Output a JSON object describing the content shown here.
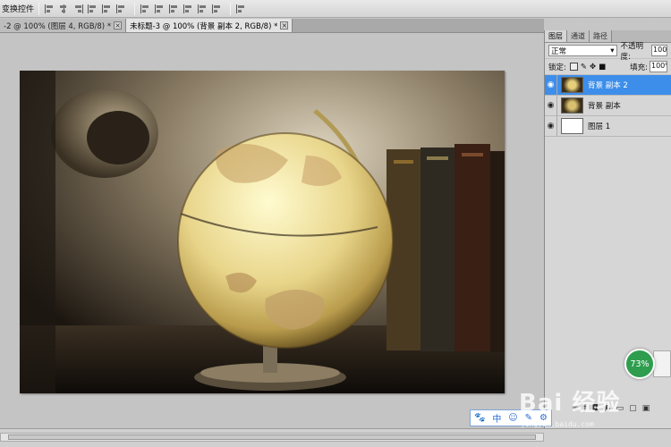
{
  "options_bar": {
    "label": "变换控件"
  },
  "tabs": [
    {
      "label": "-2 @ 100% (图层 4, RGB/8) *",
      "close": "×",
      "active": false
    },
    {
      "label": "未标题-3 @ 100% (背景 副本 2, RGB/8) *",
      "close": "×",
      "active": true
    }
  ],
  "layers_panel": {
    "tabs": [
      "图层",
      "通道",
      "路径"
    ],
    "blend_mode": "正常",
    "opacity_label": "不透明度:",
    "opacity_value": "100%",
    "lock_label": "锁定:",
    "fill_label": "填充:",
    "fill_value": "100%",
    "layers": [
      {
        "name": "背景 副本 2",
        "selected": true
      },
      {
        "name": "背景 副本",
        "selected": false
      },
      {
        "name": "图层 1",
        "selected": false
      }
    ]
  },
  "progress_badge": {
    "value": "73%"
  },
  "ime_toolbar": {
    "items": [
      "🐾",
      "中",
      "☺",
      "✎",
      "⚙"
    ]
  },
  "watermark": {
    "text": "Bai 经验",
    "sub": "jingyan.baidu.com"
  },
  "colors": {
    "selection": "#3d8eea",
    "progress": "#2e9e4e",
    "ime_accent": "#2a6bd4"
  }
}
